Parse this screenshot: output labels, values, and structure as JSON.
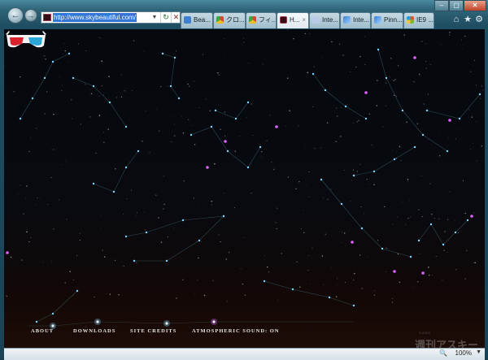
{
  "browser": {
    "address_url": "http://www.skybeautiful.com/",
    "tabs": [
      {
        "label": "Bea...",
        "icon": "ie-page-icon"
      },
      {
        "label": "クロ...",
        "icon": "chrome-icon"
      },
      {
        "label": "フィ...",
        "icon": "chrome-icon"
      },
      {
        "label": "H...",
        "icon": "skybeautiful-icon",
        "active": true
      },
      {
        "label": "Inte...",
        "icon": "cloud-icon"
      },
      {
        "label": "Inte...",
        "icon": "ie-icon"
      },
      {
        "label": "Pinn...",
        "icon": "ie-icon"
      },
      {
        "label": "IE9 ...",
        "icon": "windows-icon"
      }
    ],
    "tab_close_glyph": "×"
  },
  "site": {
    "nav": [
      {
        "label": "ABOUT"
      },
      {
        "label": "DOWNLOADS"
      },
      {
        "label": "SITE CREDITS"
      },
      {
        "label": "ATMOSPHERIC SOUND: ON"
      }
    ]
  },
  "watermark": {
    "text": "週刊アスキー"
  },
  "statusbar": {
    "zoom": "100%"
  },
  "colors": {
    "sky_top": "#05080d",
    "horizon": "#1e0c06",
    "star_blue": "#7fd4ff",
    "star_pink": "#e060ff",
    "constellation_line": "#4d7f8f"
  }
}
